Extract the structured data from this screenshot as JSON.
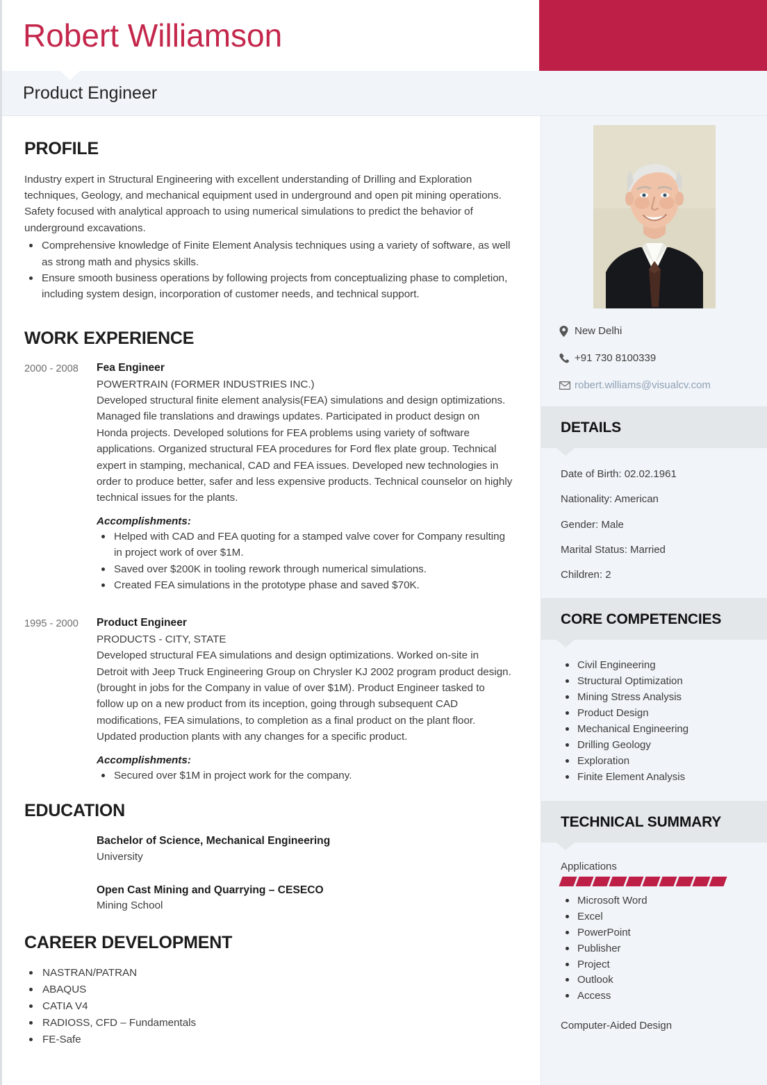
{
  "header": {
    "name": "Robert Williamson",
    "job_title": "Product Engineer",
    "accent_color": "#bd1f47",
    "name_color": "#c4274c"
  },
  "main": {
    "profile": {
      "heading": "PROFILE",
      "paragraph": "Industry expert in Structural Engineering with excellent understanding of Drilling and Exploration techniques, Geology, and mechanical equipment used in underground and open pit mining operations. Safety focused with analytical approach to using numerical simulations to predict the behavior of underground excavations.",
      "bullets": [
        "Comprehensive knowledge of Finite Element Analysis techniques using a variety of software, as well as strong math and physics skills.",
        "Ensure smooth business operations by following projects from conceptualizing phase to completion, including system design, incorporation of customer needs, and technical support."
      ]
    },
    "work_experience": {
      "heading": "WORK EXPERIENCE",
      "jobs": [
        {
          "dates": "2000 - 2008",
          "title": "Fea Engineer",
          "company": "POWERTRAIN (FORMER INDUSTRIES INC.)",
          "description": "Developed structural finite element analysis(FEA) simulations and design optimizations. Managed file translations and drawings updates. Participated in product design on Honda projects. Developed solutions for FEA problems using variety of software applications. Organized structural FEA procedures for Ford flex plate group. Technical expert in stamping, mechanical, CAD and FEA issues. Developed new technologies in order to produce better, safer and less expensive products. Technical counselor on highly technical issues for the plants.",
          "accomplishments_label": "Accomplishments:",
          "accomplishments": [
            "Helped with CAD and FEA quoting for a stamped valve cover for Company resulting in project work of over $1M.",
            "Saved over $200K in tooling rework through numerical simulations.",
            "Created FEA simulations in the prototype phase and saved $70K."
          ]
        },
        {
          "dates": "1995 - 2000",
          "title": "Product Engineer",
          "company": "PRODUCTS - CITY, STATE",
          "description": "Developed structural FEA simulations and design optimizations. Worked on-site in Detroit with Jeep Truck Engineering Group on Chrysler KJ 2002 program product design. (brought in jobs for the Company in value of over $1M). Product Engineer tasked to follow up on a new product from its inception, going through subsequent CAD modifications, FEA simulations, to completion as a final product on the plant floor. Updated production plants with any changes for a specific product.",
          "accomplishments_label": "Accomplishments:",
          "accomplishments": [
            "Secured over $1M in project work for the company."
          ]
        }
      ]
    },
    "education": {
      "heading": "EDUCATION",
      "items": [
        {
          "degree": "Bachelor of Science, Mechanical Engineering",
          "school": "University"
        },
        {
          "degree": "Open Cast Mining and Quarrying – CESECO",
          "school": "Mining School"
        }
      ]
    },
    "career_development": {
      "heading": "CAREER DEVELOPMENT",
      "items": [
        "NASTRAN/PATRAN",
        "ABAQUS",
        "CATIA V4",
        "RADIOSS, CFD – Fundamentals",
        "FE-Safe"
      ]
    }
  },
  "sidebar": {
    "contact": [
      {
        "icon": "location-pin-icon",
        "text": "New Delhi",
        "link": false
      },
      {
        "icon": "phone-icon",
        "text": "+91 730 8100339",
        "link": false
      },
      {
        "icon": "envelope-icon",
        "text": "robert.williams@visualcv.com",
        "link": true
      }
    ],
    "details": {
      "heading": "DETAILS",
      "lines": [
        "Date of Birth: 02.02.1961",
        "Nationality: American",
        "Gender: Male",
        "Marital Status: Married",
        "Children: 2"
      ]
    },
    "core_competencies": {
      "heading": "CORE COMPETENCIES",
      "items": [
        "Civil Engineering",
        "Structural Optimization",
        "Mining Stress Analysis",
        "Product Design",
        "Mechanical Engineering",
        "Drilling Geology",
        "Exploration",
        "Finite Element Analysis"
      ]
    },
    "technical_summary": {
      "heading": "TECHNICAL SUMMARY",
      "groups": [
        {
          "label": "Applications",
          "rating_segments": 10,
          "rating_color": "#bd1f47",
          "items": [
            "Microsoft Word",
            "Excel",
            "PowerPoint",
            "Publisher",
            "Project",
            "Outlook",
            "Access"
          ]
        },
        {
          "label": "Computer-Aided Design",
          "rating_segments": 0,
          "rating_color": "#bd1f47",
          "items": []
        }
      ]
    }
  }
}
